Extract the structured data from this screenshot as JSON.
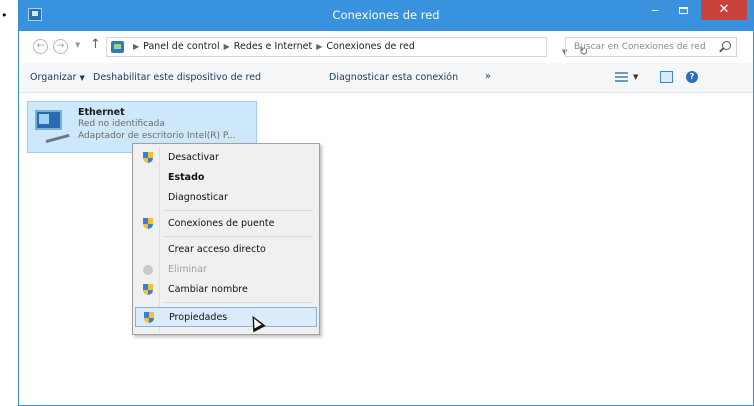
{
  "bullet": "•",
  "window": {
    "title": "Conexiones de red",
    "minimize_glyph": "‒",
    "close_glyph": "✕"
  },
  "address": {
    "breadcrumbs": [
      "Panel de control",
      "Redes e Internet",
      "Conexiones de red"
    ],
    "search_placeholder": "Buscar en Conexiones de red"
  },
  "toolbar": {
    "organize": "Organizar",
    "disable": "Deshabilitar este dispositivo de red",
    "diagnose": "Diagnosticar esta conexión",
    "more": "»"
  },
  "connection": {
    "name": "Ethernet",
    "status": "Red no identificada",
    "adapter": "Adaptador de escritorio Intel(R) P..."
  },
  "context_menu": {
    "items": [
      {
        "label": "Desactivar",
        "icon": "shield-icon"
      },
      {
        "label": "Estado",
        "bold": true
      },
      {
        "label": "Diagnosticar"
      },
      {
        "label": "Conexiones de puente",
        "icon": "shield-icon"
      },
      {
        "label": "Crear acceso directo"
      },
      {
        "label": "Eliminar",
        "icon": "disabled-icon",
        "disabled": true
      },
      {
        "label": "Cambiar nombre",
        "icon": "shield-icon"
      },
      {
        "label": "Propiedades",
        "icon": "shield-icon",
        "highlighted": true
      }
    ]
  },
  "colors": {
    "titlebar": "#3892de",
    "close_button": "#c7423a",
    "selection": "#cde8fb",
    "menu_highlight": "#dcebfa"
  }
}
